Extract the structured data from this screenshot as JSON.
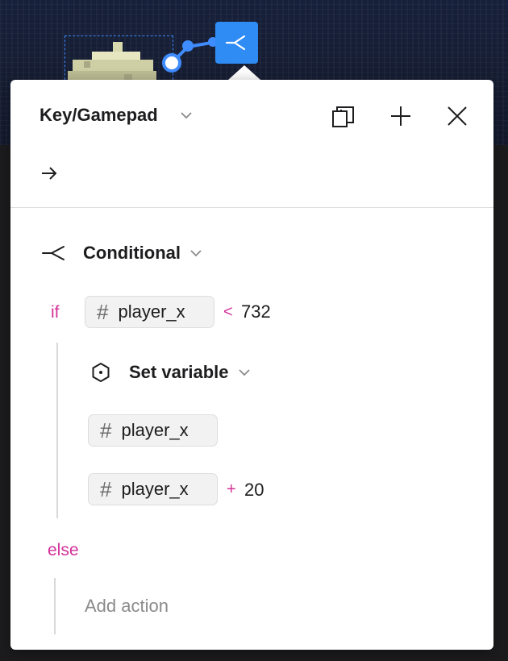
{
  "canvas": {
    "node_icon": "branch-icon",
    "accent_color": "#2f8cf5"
  },
  "panel": {
    "trigger": {
      "label": "Key/Gamepad",
      "icons": [
        "chevron-down-icon",
        "duplicate-icon",
        "plus-icon",
        "close-icon",
        "arrow-right-icon"
      ]
    },
    "conditional": {
      "icon": "branch-icon",
      "label": "Conditional",
      "if_keyword": "if",
      "condition": {
        "variable": "player_x",
        "operator": "<",
        "value": "732"
      },
      "then": {
        "action": {
          "icon": "hexagon-icon",
          "label": "Set variable",
          "target_variable": "player_x",
          "expression": {
            "variable": "player_x",
            "operator": "+",
            "value": "20"
          }
        }
      },
      "else_keyword": "else",
      "add_action_label": "Add action"
    },
    "keyword_color": "#d3309a"
  }
}
